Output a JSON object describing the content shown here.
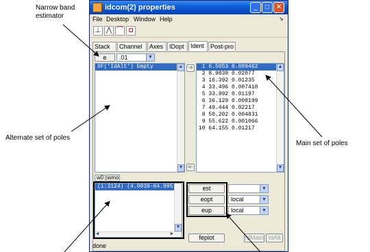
{
  "annotations": {
    "narrow_band_l1": "Narrow band",
    "narrow_band_l2": "estimator",
    "alternate": "Alternate set of poles",
    "main": "Main set of poles"
  },
  "window": {
    "title": "idcom(2) properties",
    "menus": [
      "File",
      "Desktop",
      "Window",
      "Help"
    ],
    "tools": [
      "ruler-tool-icon",
      "lines-tool-icon",
      "curve-tool-icon",
      "record-tool-icon"
    ],
    "tabs": [
      "Stack",
      "Channel",
      "Axes",
      "IDopt",
      "Ident",
      "Post-pro"
    ],
    "active_tab": "Ident"
  },
  "ident": {
    "e_button": "e",
    "band_value": ".01",
    "move_right": "->",
    "move_left": "<-",
    "alt_list": [
      "XF('IdAlt') Empty"
    ],
    "main_list": [
      " 1 6.5053 0.009462",
      " 2 8.9839 0.02077",
      " 3 16.392 0.01235",
      " 4 33.496 0.007418",
      " 5 33.992 0.01197",
      " 6 36.129 0.008199",
      " 7 49.444 0.02217",
      " 8 50.202 0.004831",
      " 9 55.622 0.001066",
      "10 64.155 0.01217"
    ],
    "small_buttons": [
      "w0",
      "wmo"
    ],
    "range_list": [
      "(1:3124) (4.0039-64.995"
    ],
    "est_label": "est",
    "eopt_label": "eopt",
    "eup_label": "eup",
    "est_value": "",
    "eopt_value": "local",
    "eup_value": "local",
    "feplot_label": "feplot",
    "idmain_label": "IdMain",
    "idalt_label": "IdAlt",
    "status": "done"
  }
}
